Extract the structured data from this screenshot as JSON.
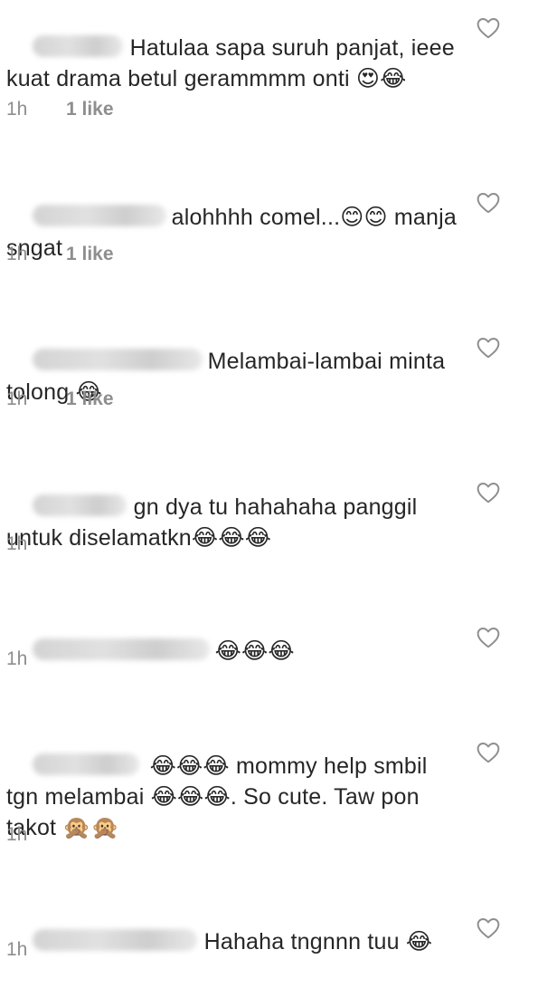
{
  "comments": [
    {
      "text": "Hatulaa sapa suruh panjat, ieee kuat drama betul gerammmm onti 😍😂",
      "time": "1h",
      "likes": "1 like"
    },
    {
      "text": "alohhhh comel...😊😊 manja sngat",
      "time": "1h",
      "likes": "1 like"
    },
    {
      "text": "Melambai-lambai minta tolong 😂",
      "time": "1h",
      "likes": "1 like"
    },
    {
      "text": "gn dya tu hahahaha panggil untuk diselamatkn😂😂😂",
      "time": "1h",
      "likes": ""
    },
    {
      "text": "😂😂😂",
      "time": "1h",
      "likes": ""
    },
    {
      "text": "😂😂😂 mommy help smbil tgn melambai 😂😂😂. So cute. Taw pon takot 🙊🙊",
      "time": "1h",
      "likes": ""
    },
    {
      "text": "Hahaha tngnnn tuu 😂",
      "time": "1h",
      "likes": ""
    }
  ],
  "icons": {
    "like": "heart-outline-icon"
  },
  "colors": {
    "text": "#262626",
    "meta": "#8e8e8e",
    "icon": "#8e8e8e"
  }
}
